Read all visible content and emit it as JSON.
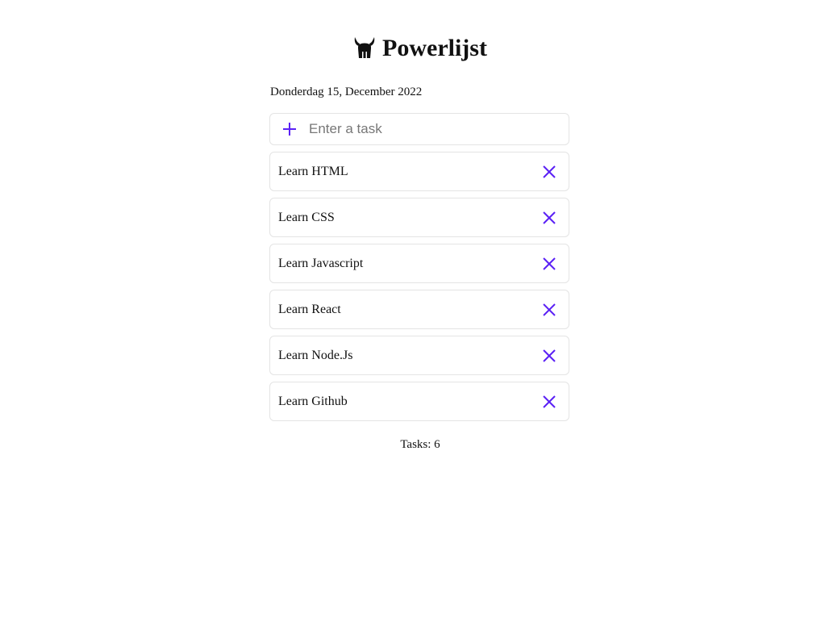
{
  "app": {
    "title": "Powerlijst",
    "logo_icon": "viking-helmet-icon"
  },
  "date": {
    "text": "Donderdag 15, December 2022"
  },
  "new_task": {
    "placeholder": "Enter a task",
    "value": "",
    "add_icon": "plus-icon"
  },
  "tasks": [
    {
      "label": "Learn HTML",
      "delete_icon": "close-icon"
    },
    {
      "label": "Learn CSS",
      "delete_icon": "close-icon"
    },
    {
      "label": "Learn Javascript",
      "delete_icon": "close-icon"
    },
    {
      "label": "Learn React",
      "delete_icon": "close-icon"
    },
    {
      "label": "Learn Node.Js",
      "delete_icon": "close-icon"
    },
    {
      "label": "Learn Github",
      "delete_icon": "close-icon"
    }
  ],
  "footer": {
    "count_text": "Tasks: 6"
  },
  "colors": {
    "accent": "#5b21f5",
    "border": "#e4e4e4",
    "text": "#111111",
    "placeholder": "#777777"
  }
}
